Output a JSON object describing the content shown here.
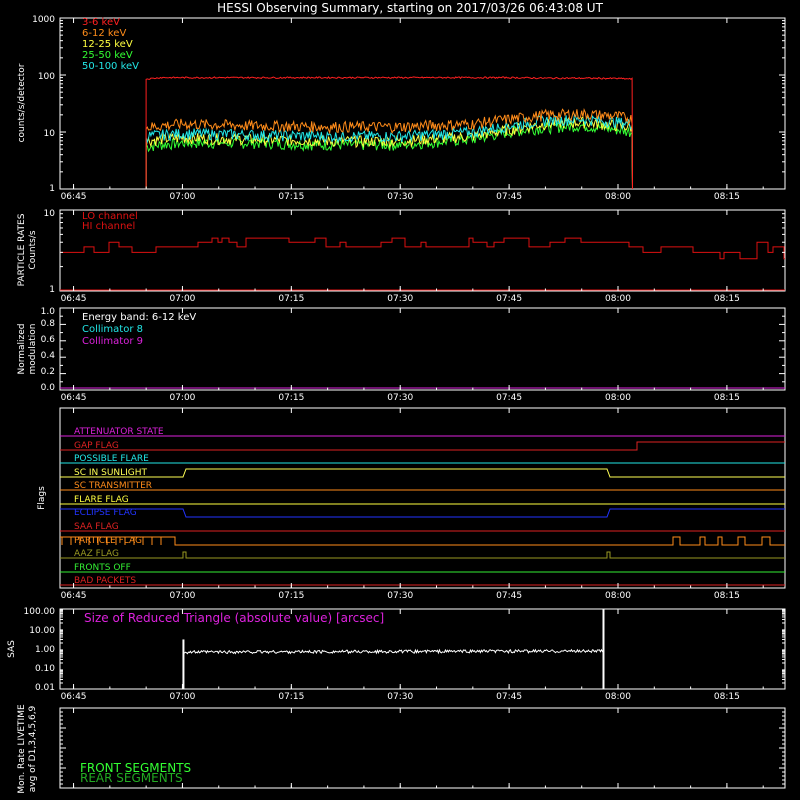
{
  "title": "HESSI Observing Summary, starting on 2017/03/26 06:43:08 UT",
  "x_ticks": [
    "06:45",
    "07:00",
    "07:15",
    "07:30",
    "07:45",
    "08:00",
    "08:15"
  ],
  "chart_data": [
    {
      "type": "line",
      "name": "counts",
      "ylabel": "counts/s/detector",
      "yscale": "log",
      "ylim": [
        1,
        1000
      ],
      "y_ticks": [
        "1",
        "10",
        "100",
        "1000"
      ],
      "x": [
        "06:55",
        "06:57",
        "07:00",
        "07:10",
        "07:20",
        "07:30",
        "07:40",
        "07:45",
        "07:50",
        "07:55",
        "08:00",
        "08:02"
      ],
      "series": [
        {
          "name": "3-6 keV",
          "color": "#ff2020",
          "values": [
            85,
            90,
            90,
            90,
            90,
            90,
            90,
            90,
            88,
            88,
            87,
            85
          ]
        },
        {
          "name": "6-12 keV",
          "color": "#ff8c1a",
          "values": [
            12,
            13,
            14,
            13,
            12.5,
            12.5,
            14,
            17,
            20,
            21,
            19,
            17
          ]
        },
        {
          "name": "12-25 keV",
          "color": "#ffff40",
          "values": [
            7,
            7.5,
            8,
            7.5,
            7,
            7,
            8.5,
            11,
            14,
            15,
            13,
            12
          ]
        },
        {
          "name": "25-50 keV",
          "color": "#33ff33",
          "values": [
            5.5,
            6,
            6.5,
            6.5,
            6,
            6,
            7.5,
            10,
            12,
            13,
            11,
            10
          ]
        },
        {
          "name": "50-100 keV",
          "color": "#22e6e6",
          "values": [
            8.5,
            9,
            9.5,
            9,
            8.5,
            8.5,
            10,
            13,
            16,
            17,
            15,
            14
          ]
        }
      ]
    },
    {
      "type": "line",
      "name": "particle",
      "ylabel_lines": [
        "PARTICLE RATES",
        "Counts/s"
      ],
      "yscale": "log",
      "ylim": [
        1,
        10
      ],
      "y_ticks": [
        "1",
        "10"
      ],
      "series": [
        {
          "name": "LO channel",
          "color": "#dd1111"
        },
        {
          "name": "HI channel",
          "color": "#dd1111"
        }
      ]
    },
    {
      "type": "line",
      "name": "modulation",
      "ylabel_lines": [
        "Normalized",
        "modulation"
      ],
      "ylim": [
        0,
        1
      ],
      "y_ticks": [
        "0.0",
        "0.2",
        "0.4",
        "0.6",
        "0.8",
        "1.0"
      ],
      "legend_header": "Energy band: 6-12 keV",
      "series": [
        {
          "name": "Collimator 8",
          "color": "#22e6e6",
          "value": 0.0
        },
        {
          "name": "Collimator 9",
          "color": "#dd22dd",
          "value": 0.0
        }
      ]
    },
    {
      "type": "line",
      "name": "flags",
      "ylabel": "Flags",
      "flags": [
        {
          "name": "ATTENUATOR STATE",
          "color": "#dd22dd"
        },
        {
          "name": "GAP FLAG",
          "color": "#dd2222"
        },
        {
          "name": "POSSIBLE FLARE",
          "color": "#22e6e6"
        },
        {
          "name": "SC IN SUNLIGHT",
          "color": "#ffff55"
        },
        {
          "name": "SC TRANSMITTER",
          "color": "#ff8c1a"
        },
        {
          "name": "FLARE FLAG",
          "color": "#ffff40"
        },
        {
          "name": "ECLIPSE FLAG",
          "color": "#2233ff"
        },
        {
          "name": "SAA FLAG",
          "color": "#dd2222"
        },
        {
          "name": "PARTICLE FLAG",
          "color": "#ff8c1a"
        },
        {
          "name": "AAZ FLAG",
          "color": "#999922"
        },
        {
          "name": "FRONTS OFF",
          "color": "#33ee33"
        },
        {
          "name": "BAD PACKETS",
          "color": "#dd2222"
        }
      ]
    },
    {
      "type": "line",
      "name": "sas",
      "ylabel": "SAS",
      "yscale": "log",
      "ylim": [
        0.01,
        100
      ],
      "y_ticks": [
        "0.01",
        "0.10",
        "1.00",
        "10.00",
        "100.00"
      ],
      "annotation": "Size of Reduced Triangle (absolute value) [arcsec]",
      "x": [
        "07:00",
        "07:15",
        "07:30",
        "07:45",
        "07:58"
      ],
      "values": [
        0.7,
        0.75,
        0.75,
        0.75,
        0.8
      ]
    },
    {
      "type": "line",
      "name": "livetime",
      "ylabel_lines": [
        "Mon. Rate LIVETIME",
        "avg of D1,3,4,5,6,9"
      ],
      "series": [
        {
          "name": "FRONT SEGMENTS",
          "color": "#33ff33"
        },
        {
          "name": "REAR SEGMENTS",
          "color": "#22aa22"
        }
      ]
    }
  ]
}
